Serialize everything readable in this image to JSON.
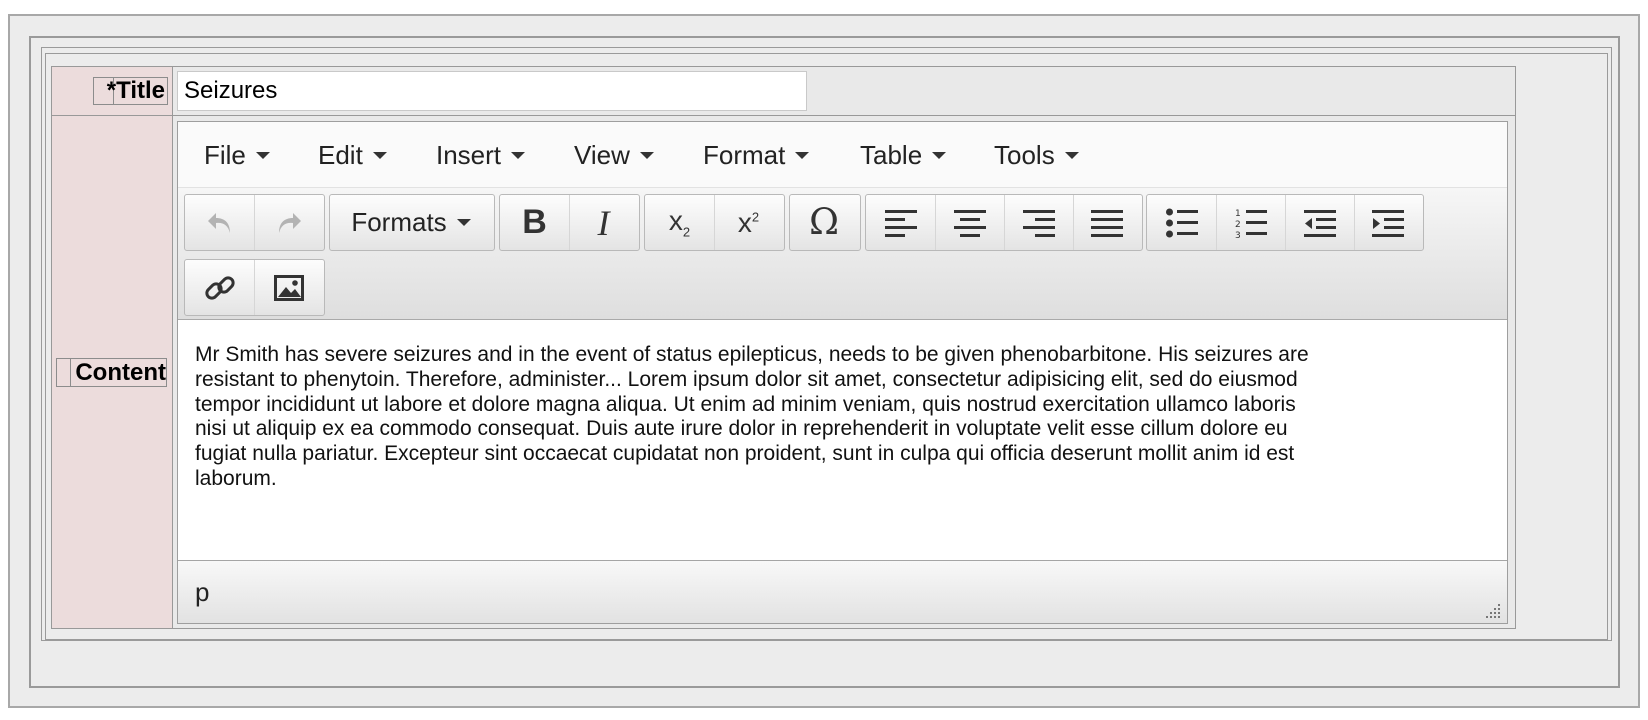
{
  "form": {
    "title_label": "*Title",
    "title_value": "Seizures",
    "content_label": "Content"
  },
  "editor": {
    "menu": [
      "File",
      "Edit",
      "Insert",
      "View",
      "Format",
      "Table",
      "Tools"
    ],
    "toolbar": {
      "undo_icon": "undo-icon",
      "redo_icon": "redo-icon",
      "formats_label": "Formats",
      "bold_icon": "bold-icon",
      "italic_icon": "italic-icon",
      "subscript_icon": "subscript-icon",
      "superscript_icon": "superscript-icon",
      "special_char_icon": "omega-icon",
      "align_icons": [
        "align-left-icon",
        "align-center-icon",
        "align-right-icon",
        "align-justify-icon"
      ],
      "list_icons": [
        "bullet-list-icon",
        "numbered-list-icon",
        "outdent-icon",
        "indent-icon"
      ],
      "link_icon": "link-icon",
      "image_icon": "image-icon"
    },
    "content_lines": [
      "Mr Smith has severe seizures and in the event of status epilepticus, needs to be given phenobarbitone. His seizures are",
      "resistant to phenytoin. Therefore, administer... Lorem ipsum dolor sit amet, consectetur adipisicing elit, sed do eiusmod",
      "tempor incididunt ut labore et dolore magna aliqua. Ut enim ad minim veniam, quis nostrud exercitation ullamco laboris",
      "nisi ut aliquip ex ea commodo consequat. Duis aute irure dolor in reprehenderit in voluptate velit esse cillum dolore eu",
      "fugiat nulla pariatur. Excepteur sint occaecat cupidatat non proident, sunt in culpa qui officia deserunt mollit anim id est",
      "laborum."
    ],
    "status_path": "p"
  },
  "colors": {
    "label_cell_bg": "#ecdcdc",
    "field_cell_bg": "#e9e9e9",
    "toolbar_bg": "#e6e6e6"
  }
}
